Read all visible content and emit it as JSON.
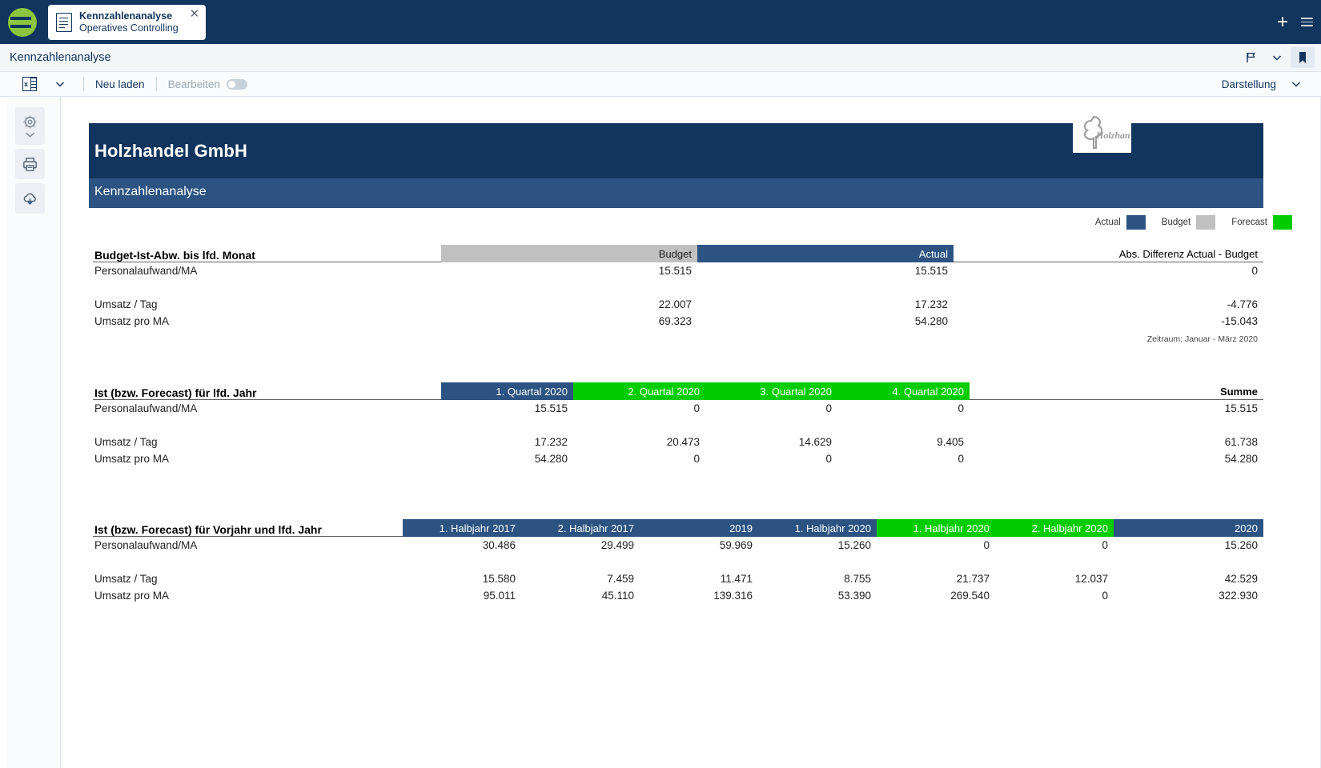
{
  "titlebar": {
    "tab": {
      "title": "Kennzahlenanalyse",
      "subtitle": "Operatives Controlling",
      "close": "✕"
    },
    "add_label": "+",
    "logo_name": "app-logo"
  },
  "subheader": {
    "title": "Kennzahlenanalyse"
  },
  "toolbar": {
    "excel_label": "x",
    "reload_label": "Neu laden",
    "edit_label": "Bearbeiten",
    "view_label": "Darstellung"
  },
  "rail": {
    "settings_label": "gear",
    "print_label": "print",
    "download_label": "download"
  },
  "report": {
    "company": "Holzhandel GmbH",
    "subtitle": "Kennzahlenanalyse",
    "logo_text": "Holzhandel"
  },
  "legend": [
    {
      "label": "Actual",
      "color": "#2c5381"
    },
    {
      "label": "Budget",
      "color": "#c0c0c0"
    },
    {
      "label": "Forecast",
      "color": "#00cc00"
    }
  ],
  "colors": {
    "actual": "#2c5381",
    "budget": "#c0c0c0",
    "forecast": "#00cc00",
    "header_dark": "#11355e",
    "header_mid": "#2c5381"
  },
  "sections": [
    {
      "title": "Budget-Ist-Abw. bis lfd. Monat",
      "columns": [
        {
          "label": "Budget",
          "kind": "budget"
        },
        {
          "label": "Actual",
          "kind": "actual"
        },
        {
          "label": "Abs. Differenz  Actual - Budget",
          "kind": "plain"
        }
      ],
      "rows": [
        {
          "label": "Personalaufwand/MA",
          "values": [
            "15.515",
            "15.515",
            "0"
          ]
        },
        {
          "label": "",
          "values": [
            "",
            "",
            ""
          ]
        },
        {
          "label": "Umsatz / Tag",
          "values": [
            "22.007",
            "17.232",
            "-4.776"
          ]
        },
        {
          "label": "Umsatz pro MA",
          "values": [
            "69.323",
            "54.280",
            "-15.043"
          ]
        }
      ],
      "note": "Zeitraum: Januar - März 2020"
    },
    {
      "title": "Ist (bzw. Forecast) für lfd. Jahr",
      "columns": [
        {
          "label": "1. Quartal 2020",
          "kind": "actual"
        },
        {
          "label": "2. Quartal 2020",
          "kind": "forecast"
        },
        {
          "label": "3. Quartal 2020",
          "kind": "forecast"
        },
        {
          "label": "4. Quartal 2020",
          "kind": "forecast"
        },
        {
          "label": "Summe",
          "kind": "plain"
        }
      ],
      "rows": [
        {
          "label": "Personalaufwand/MA",
          "values": [
            "15.515",
            "0",
            "0",
            "0",
            "15.515"
          ]
        },
        {
          "label": "",
          "values": [
            "",
            "",
            "",
            "",
            ""
          ]
        },
        {
          "label": "Umsatz / Tag",
          "values": [
            "17.232",
            "20.473",
            "14.629",
            "9.405",
            "61.738"
          ]
        },
        {
          "label": "Umsatz pro MA",
          "values": [
            "54.280",
            "0",
            "0",
            "0",
            "54.280"
          ]
        }
      ],
      "note": ""
    },
    {
      "title": "Ist (bzw. Forecast) für Vorjahr und lfd. Jahr",
      "columns": [
        {
          "label": "1. Halbjahr 2017",
          "kind": "actual"
        },
        {
          "label": "2. Halbjahr 2017",
          "kind": "actual"
        },
        {
          "label": "2019",
          "kind": "actual"
        },
        {
          "label": "1. Halbjahr 2020",
          "kind": "actual"
        },
        {
          "label": "1. Halbjahr 2020",
          "kind": "forecast"
        },
        {
          "label": "2. Halbjahr 2020",
          "kind": "forecast"
        },
        {
          "label": "2020",
          "kind": "actual"
        }
      ],
      "rows": [
        {
          "label": "Personalaufwand/MA",
          "values": [
            "30.486",
            "29.499",
            "59.969",
            "15.260",
            "0",
            "0",
            "15.260"
          ]
        },
        {
          "label": "",
          "values": [
            "",
            "",
            "",
            "",
            "",
            "",
            ""
          ]
        },
        {
          "label": "Umsatz / Tag",
          "values": [
            "15.580",
            "7.459",
            "11.471",
            "8.755",
            "21.737",
            "12.037",
            "42.529"
          ]
        },
        {
          "label": "Umsatz pro MA",
          "values": [
            "95.011",
            "45.110",
            "139.316",
            "53.390",
            "269.540",
            "0",
            "322.930"
          ]
        }
      ],
      "note": ""
    }
  ]
}
